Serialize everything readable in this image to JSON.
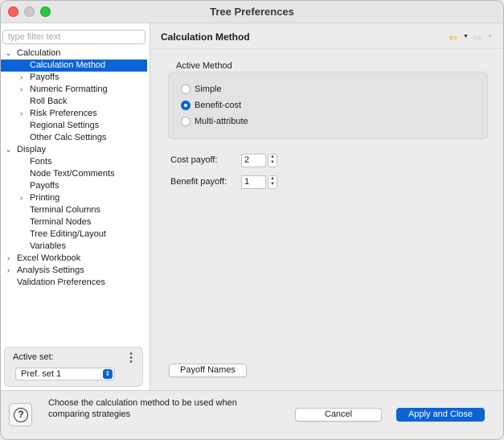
{
  "window": {
    "title": "Tree Preferences"
  },
  "sidebar": {
    "filter_placeholder": "type filter text",
    "tree": [
      {
        "label": "Calculation",
        "level": 0,
        "toggle": "expanded"
      },
      {
        "label": "Calculation Method",
        "level": 1,
        "toggle": "none",
        "selected": true
      },
      {
        "label": "Payoffs",
        "level": 1,
        "toggle": "collapsed"
      },
      {
        "label": "Numeric Formatting",
        "level": 1,
        "toggle": "collapsed"
      },
      {
        "label": "Roll Back",
        "level": 1,
        "toggle": "none"
      },
      {
        "label": "Risk Preferences",
        "level": 1,
        "toggle": "collapsed"
      },
      {
        "label": "Regional Settings",
        "level": 1,
        "toggle": "none"
      },
      {
        "label": "Other Calc Settings",
        "level": 1,
        "toggle": "none"
      },
      {
        "label": "Display",
        "level": 0,
        "toggle": "expanded"
      },
      {
        "label": "Fonts",
        "level": 1,
        "toggle": "none"
      },
      {
        "label": "Node Text/Comments",
        "level": 1,
        "toggle": "none"
      },
      {
        "label": "Payoffs",
        "level": 1,
        "toggle": "none"
      },
      {
        "label": "Printing",
        "level": 1,
        "toggle": "collapsed"
      },
      {
        "label": "Terminal Columns",
        "level": 1,
        "toggle": "none"
      },
      {
        "label": "Terminal Nodes",
        "level": 1,
        "toggle": "none"
      },
      {
        "label": "Tree Editing/Layout",
        "level": 1,
        "toggle": "none"
      },
      {
        "label": "Variables",
        "level": 1,
        "toggle": "none"
      },
      {
        "label": "Excel Workbook",
        "level": 0,
        "toggle": "collapsed"
      },
      {
        "label": "Analysis Settings",
        "level": 0,
        "toggle": "collapsed"
      },
      {
        "label": "Validation Preferences",
        "level": 0,
        "toggle": "none"
      }
    ],
    "active_set": {
      "label": "Active set:",
      "value": "Pref. set 1"
    }
  },
  "main": {
    "title": "Calculation Method",
    "group_label": "Active Method",
    "methods": [
      "Simple",
      "Benefit-cost",
      "Multi-attribute"
    ],
    "selected_method": "Benefit-cost",
    "cost_payoff": {
      "label": "Cost payoff:",
      "value": "2"
    },
    "benefit_payoff": {
      "label": "Benefit payoff:",
      "value": "1"
    },
    "payoff_names_button": "Payoff Names"
  },
  "footer": {
    "hint": "Choose the calculation method to be used when comparing strategies",
    "cancel_label": "Cancel",
    "apply_label": "Apply and Close"
  },
  "colors": {
    "accent": "#0b63d6",
    "nav_back": "#e8a100"
  }
}
